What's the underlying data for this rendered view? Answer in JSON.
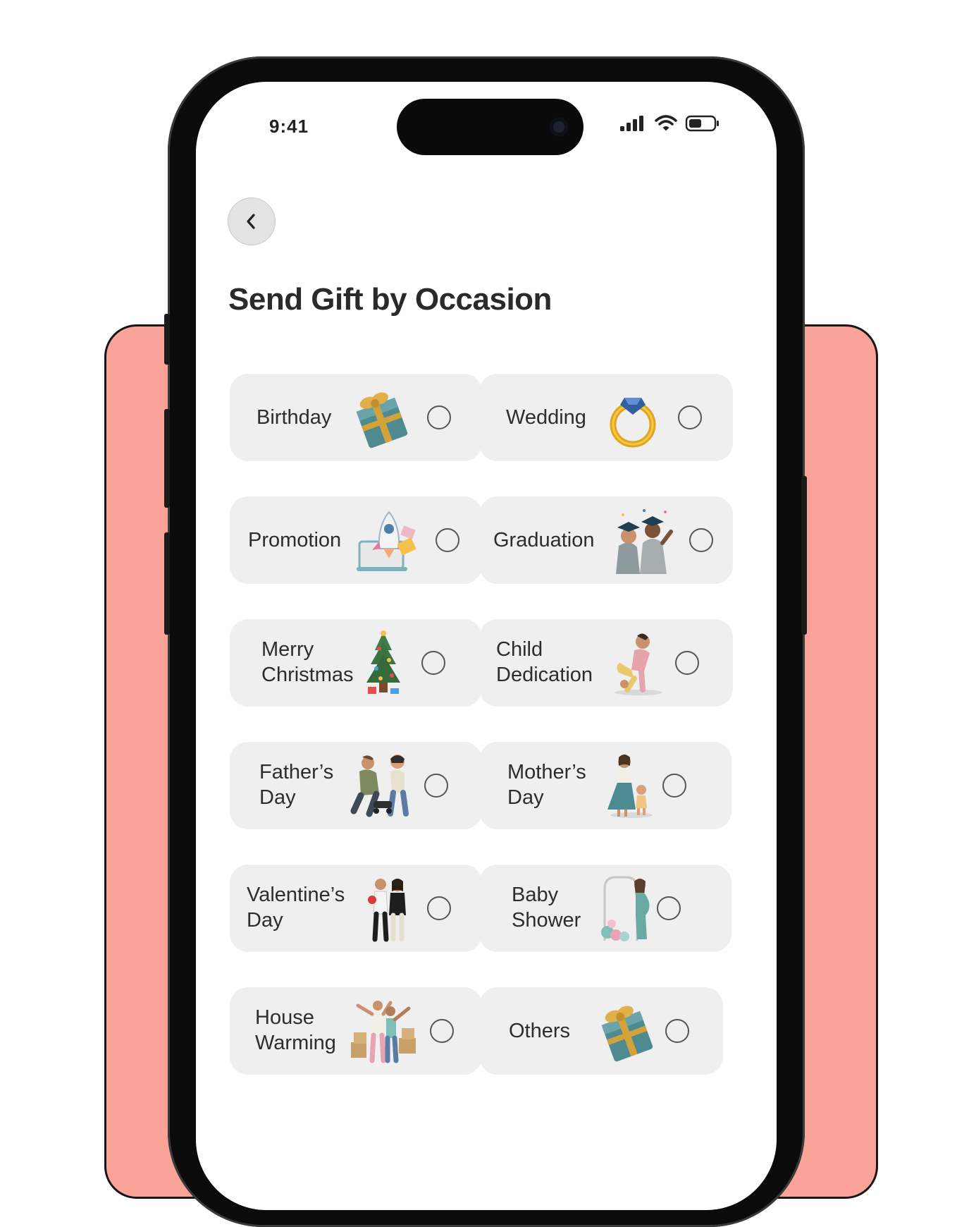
{
  "status_bar": {
    "time": "9:41"
  },
  "header": {
    "back_icon": "chevron-left-icon",
    "title": "Send Gift by Occasion"
  },
  "colors": {
    "backdrop": "#f9a399",
    "card_background": "#efefef",
    "title_text": "#2a2a2a"
  },
  "occasions": [
    {
      "label": "Birthday",
      "icon": "gift-box-icon",
      "selected": false
    },
    {
      "label": "Wedding",
      "icon": "ring-icon",
      "selected": false
    },
    {
      "label": "Promotion",
      "icon": "rocket-icon",
      "selected": false
    },
    {
      "label": "Graduation",
      "icon": "graduates-icon",
      "selected": false
    },
    {
      "label": "Merry\nChristmas",
      "icon": "christmas-tree-icon",
      "selected": false
    },
    {
      "label": "Child\nDedication",
      "icon": "mother-child-icon",
      "selected": false
    },
    {
      "label": "Father’s\nDay",
      "icon": "father-son-icon",
      "selected": false
    },
    {
      "label": "Mother’s\nDay",
      "icon": "mother-daughter-icon",
      "selected": false
    },
    {
      "label": "Valentine’s\nDay",
      "icon": "couple-icon",
      "selected": false
    },
    {
      "label": "Baby\nShower",
      "icon": "pregnant-woman-icon",
      "selected": false
    },
    {
      "label": "House\nWarming",
      "icon": "moving-couple-icon",
      "selected": false
    },
    {
      "label": "Others",
      "icon": "gift-box-icon",
      "selected": false
    }
  ]
}
